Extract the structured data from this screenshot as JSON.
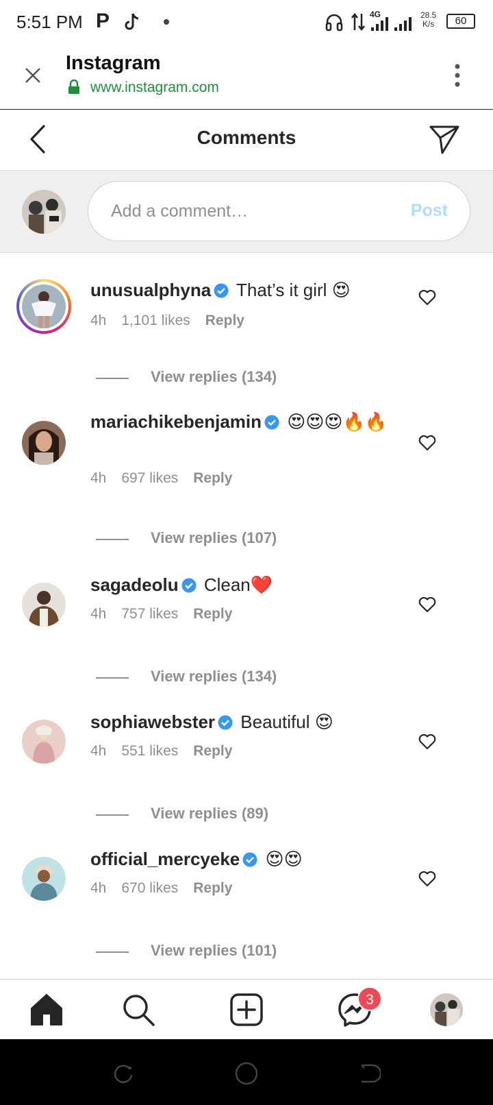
{
  "status_bar": {
    "time": "5:51 PM",
    "app_icons": [
      "P",
      "tiktok"
    ],
    "network_speed": "28.5",
    "network_unit": "K/s",
    "battery": "60",
    "network_type": "4G"
  },
  "browser": {
    "title": "Instagram",
    "url": "www.instagram.com"
  },
  "header": {
    "title": "Comments"
  },
  "comment_input": {
    "placeholder": "Add a comment…",
    "post_label": "Post"
  },
  "comments": [
    {
      "username": "unusualphyna",
      "verified": true,
      "text": " That’s it girl 😍",
      "time": "4h",
      "likes": "1,101 likes",
      "reply_label": "Reply",
      "view_replies": "View replies (134)"
    },
    {
      "username": "mariachikebenjamin",
      "verified": true,
      "text": " 😍😍😍🔥🔥",
      "time": "4h",
      "likes": "697 likes",
      "reply_label": "Reply",
      "view_replies": "View replies (107)"
    },
    {
      "username": "sagadeolu",
      "verified": true,
      "text": " Clean❤️",
      "time": "4h",
      "likes": "757 likes",
      "reply_label": "Reply",
      "view_replies": "View replies (134)"
    },
    {
      "username": "sophiawebster",
      "verified": true,
      "text": " Beautiful 😍",
      "time": "4h",
      "likes": "551 likes",
      "reply_label": "Reply",
      "view_replies": "View replies (89)"
    },
    {
      "username": "official_mercyeke",
      "verified": true,
      "text": " 😍😍",
      "time": "4h",
      "likes": "670 likes",
      "reply_label": "Reply",
      "view_replies": "View replies (101)"
    }
  ],
  "bottom_nav": {
    "items": [
      "home-icon",
      "search-icon",
      "new-post-icon",
      "messenger-icon",
      "profile-avatar"
    ],
    "messenger_badge": "3"
  },
  "colors": {
    "accent_blue": "#0095f6",
    "post_disabled": "#b3dbff",
    "verified_blue": "#3897f0",
    "secure_green": "#1f8f3c",
    "badge_red": "#ed4956"
  }
}
